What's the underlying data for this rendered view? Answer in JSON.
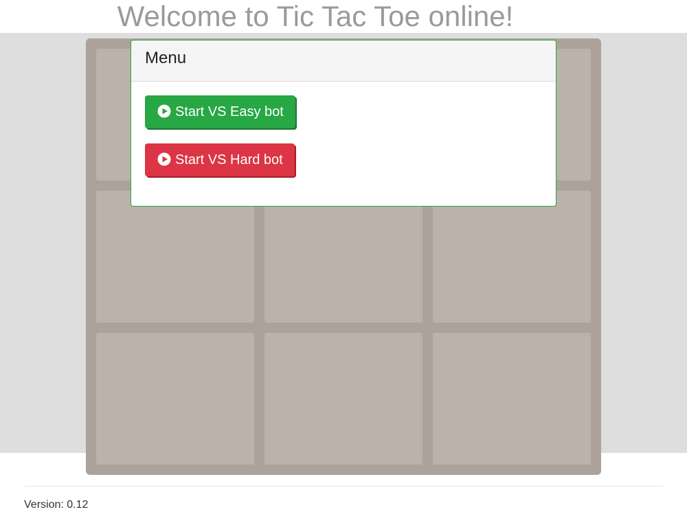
{
  "header": {
    "title": "Welcome to Tic Tac Toe online!"
  },
  "board": {
    "cells": [
      "",
      "",
      "",
      "",
      "",
      "",
      "",
      "",
      ""
    ]
  },
  "menu": {
    "title": "Menu",
    "buttons": {
      "easy_label": "Start VS Easy bot",
      "hard_label": "Start VS Hard bot"
    },
    "icon": "play-circle-icon"
  },
  "footer": {
    "version": "Version: 0.12"
  },
  "colors": {
    "easy_button": "#28a745",
    "hard_button": "#dc3545",
    "menu_border": "#28a745",
    "board": "#ada29a",
    "cell": "#bbb2a9",
    "title": "#9a9a9a"
  }
}
